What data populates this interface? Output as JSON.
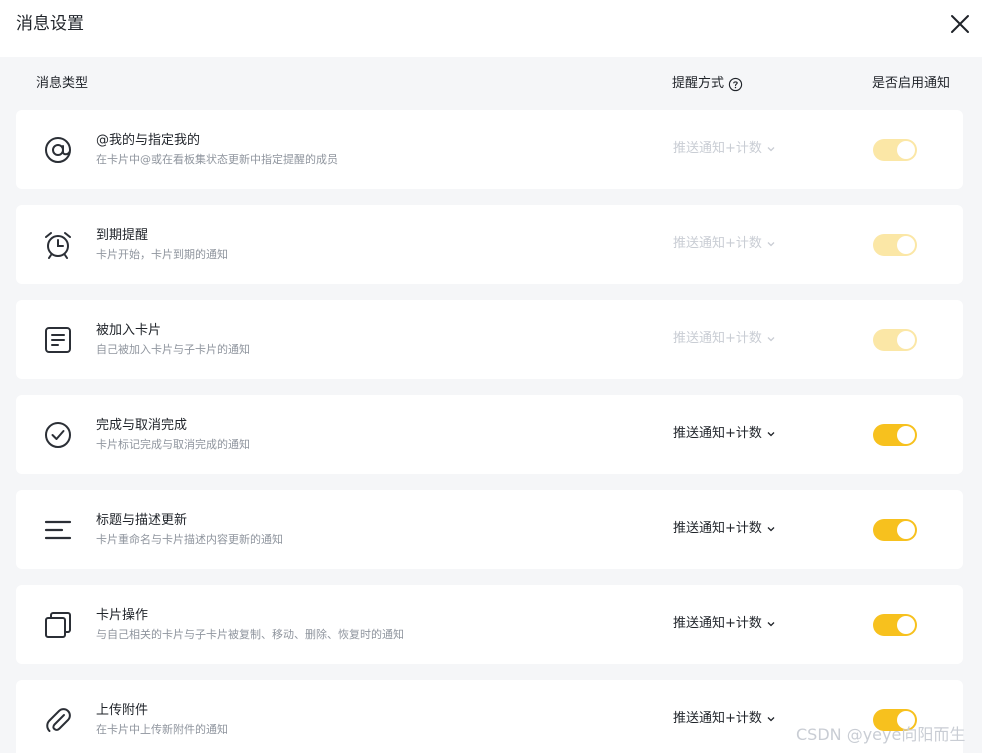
{
  "dialog": {
    "title": "消息设置"
  },
  "columns": {
    "type": "消息类型",
    "method": "提醒方式",
    "enable": "是否启用通知"
  },
  "rows": [
    {
      "icon": "at-icon",
      "title": "@我的与指定我的",
      "desc": "在卡片中@或在看板集状态更新中指定提醒的成员",
      "method": "推送通知+计数",
      "enabled": true,
      "locked": true
    },
    {
      "icon": "alarm-clock-icon",
      "title": "到期提醒",
      "desc": "卡片开始，卡片到期的通知",
      "method": "推送通知+计数",
      "enabled": true,
      "locked": true
    },
    {
      "icon": "document-icon",
      "title": "被加入卡片",
      "desc": "自己被加入卡片与子卡片的通知",
      "method": "推送通知+计数",
      "enabled": true,
      "locked": true
    },
    {
      "icon": "check-circle-icon",
      "title": "完成与取消完成",
      "desc": "卡片标记完成与取消完成的通知",
      "method": "推送通知+计数",
      "enabled": true,
      "locked": false
    },
    {
      "icon": "text-lines-icon",
      "title": "标题与描述更新",
      "desc": "卡片重命名与卡片描述内容更新的通知",
      "method": "推送通知+计数",
      "enabled": true,
      "locked": false
    },
    {
      "icon": "copy-icon",
      "title": "卡片操作",
      "desc": "与自己相关的卡片与子卡片被复制、移动、删除、恢复时的通知",
      "method": "推送通知+计数",
      "enabled": true,
      "locked": false
    },
    {
      "icon": "paperclip-icon",
      "title": "上传附件",
      "desc": "在卡片中上传新附件的通知",
      "method": "推送通知+计数",
      "enabled": true,
      "locked": false
    }
  ],
  "watermark": "CSDN @yeye向阳而生",
  "colors": {
    "toggle_on": "#f7c11e",
    "toggle_locked": "#fbe7a6",
    "background": "#f5f6f8"
  }
}
